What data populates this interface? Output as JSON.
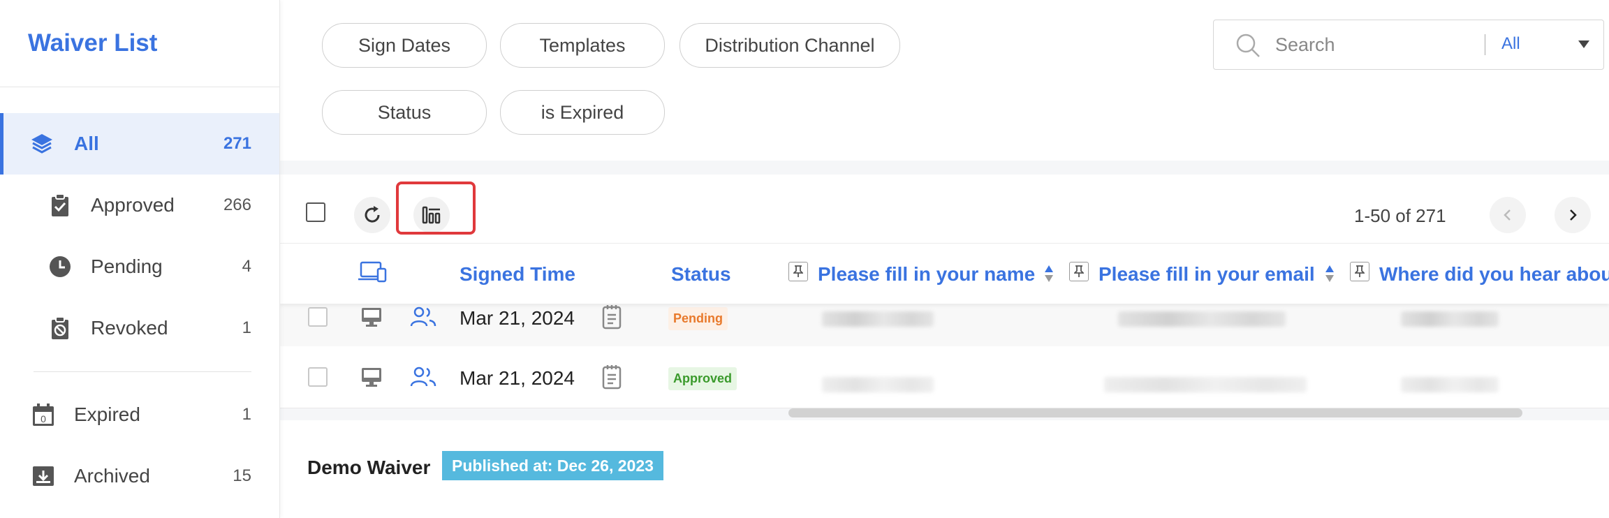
{
  "sidebar": {
    "title": "Waiver List",
    "items": [
      {
        "label": "All",
        "count": "271"
      },
      {
        "label": "Approved",
        "count": "266"
      },
      {
        "label": "Pending",
        "count": "4"
      },
      {
        "label": "Revoked",
        "count": "1"
      },
      {
        "label": "Expired",
        "count": "1"
      },
      {
        "label": "Archived",
        "count": "15"
      }
    ],
    "expired_icon_text": "0"
  },
  "filters": {
    "pills": [
      "Sign Dates",
      "Templates",
      "Distribution Channel",
      "Status",
      "is Expired"
    ]
  },
  "search": {
    "placeholder": "Search",
    "scope": "All"
  },
  "toolbar": {
    "pager": "1-50 of 271"
  },
  "table": {
    "headers": {
      "signed_time": "Signed Time",
      "status": "Status",
      "name": "Please fill in your name",
      "email": "Please fill in your email",
      "hear": "Where did you hear abou"
    },
    "rows": [
      {
        "date": "Mar 21, 2024",
        "status": "Pending"
      },
      {
        "date": "Mar 21, 2024",
        "status": "Approved"
      }
    ]
  },
  "section": {
    "title": "Demo Waiver",
    "badge": "Published at: Dec 26, 2023"
  },
  "colors": {
    "accent": "#3a73e0",
    "highlight": "#e0393c",
    "pending": "#e8792b",
    "approved": "#3a9a2b",
    "badge_bg": "#55b9de"
  }
}
